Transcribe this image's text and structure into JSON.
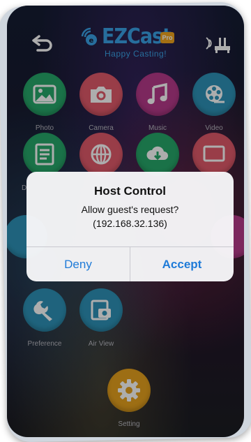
{
  "app": {
    "brand": "EZCast",
    "brand_badge": "Pro",
    "tagline": "Happy Casting!"
  },
  "colors": {
    "brand_blue": "#3aa3e8",
    "photo": "#27a86a",
    "camera": "#e25a6b",
    "music": "#b73a8b",
    "video": "#2e93b8",
    "preference": "#2e93b8",
    "airview": "#2e93b8",
    "setting": "#e7a21e",
    "dialog_button": "#1f7bd8"
  },
  "toolbar": {
    "back_icon": "back-arrow-icon",
    "cast_icon": "wireless-cast-icon"
  },
  "tiles": {
    "photo": "Photo",
    "camera": "Camera",
    "music": "Music",
    "video": "Video",
    "document_partial": "D",
    "preference": "Preference",
    "airview": "Air View",
    "setting": "Setting"
  },
  "dialog": {
    "title": "Host Control",
    "message": "Allow guest's request?",
    "ip": "(192.168.32.136)",
    "deny_label": "Deny",
    "accept_label": "Accept"
  }
}
